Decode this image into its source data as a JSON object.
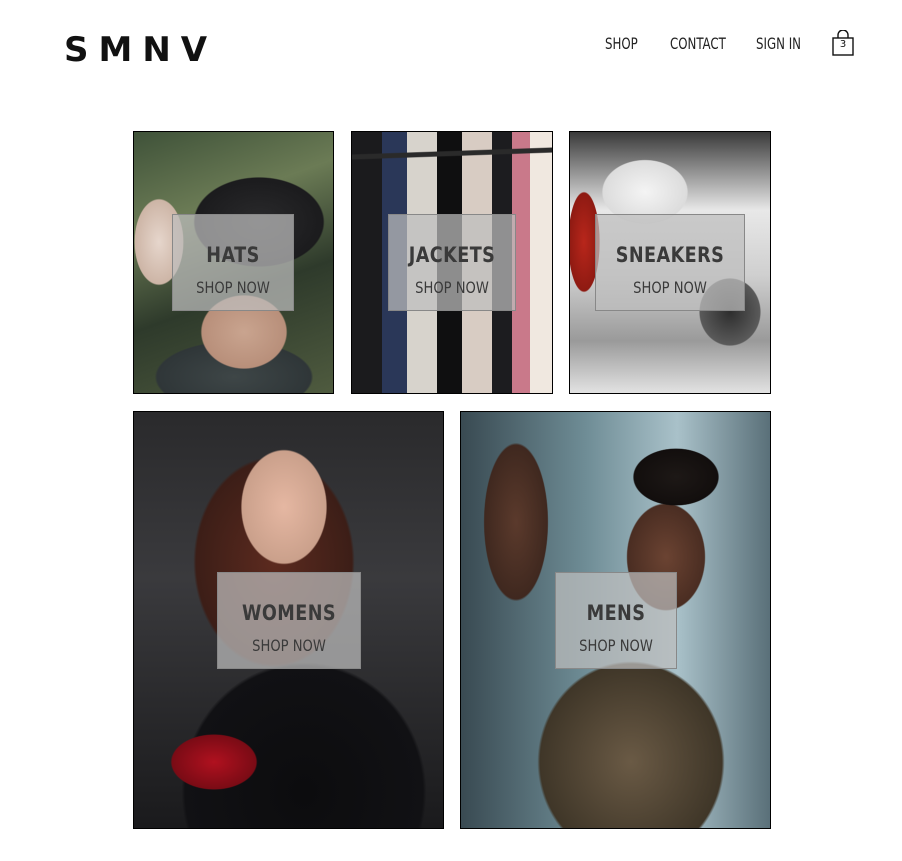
{
  "header": {
    "logo": "SMNV",
    "nav": {
      "shop": "SHOP",
      "contact": "CONTACT",
      "sign_in": "SIGN IN"
    },
    "cart": {
      "count": "3",
      "icon": "shopping-bag-icon"
    }
  },
  "categories": [
    {
      "title": "HATS",
      "cta": "SHOP NOW"
    },
    {
      "title": "JACKETS",
      "cta": "SHOP NOW"
    },
    {
      "title": "SNEAKERS",
      "cta": "SHOP NOW"
    },
    {
      "title": "WOMENS",
      "cta": "SHOP NOW"
    },
    {
      "title": "MENS",
      "cta": "SHOP NOW"
    }
  ],
  "colors": {
    "text": "#222222",
    "overlay": "#bebebe",
    "border": "#000000",
    "background": "#ffffff"
  }
}
